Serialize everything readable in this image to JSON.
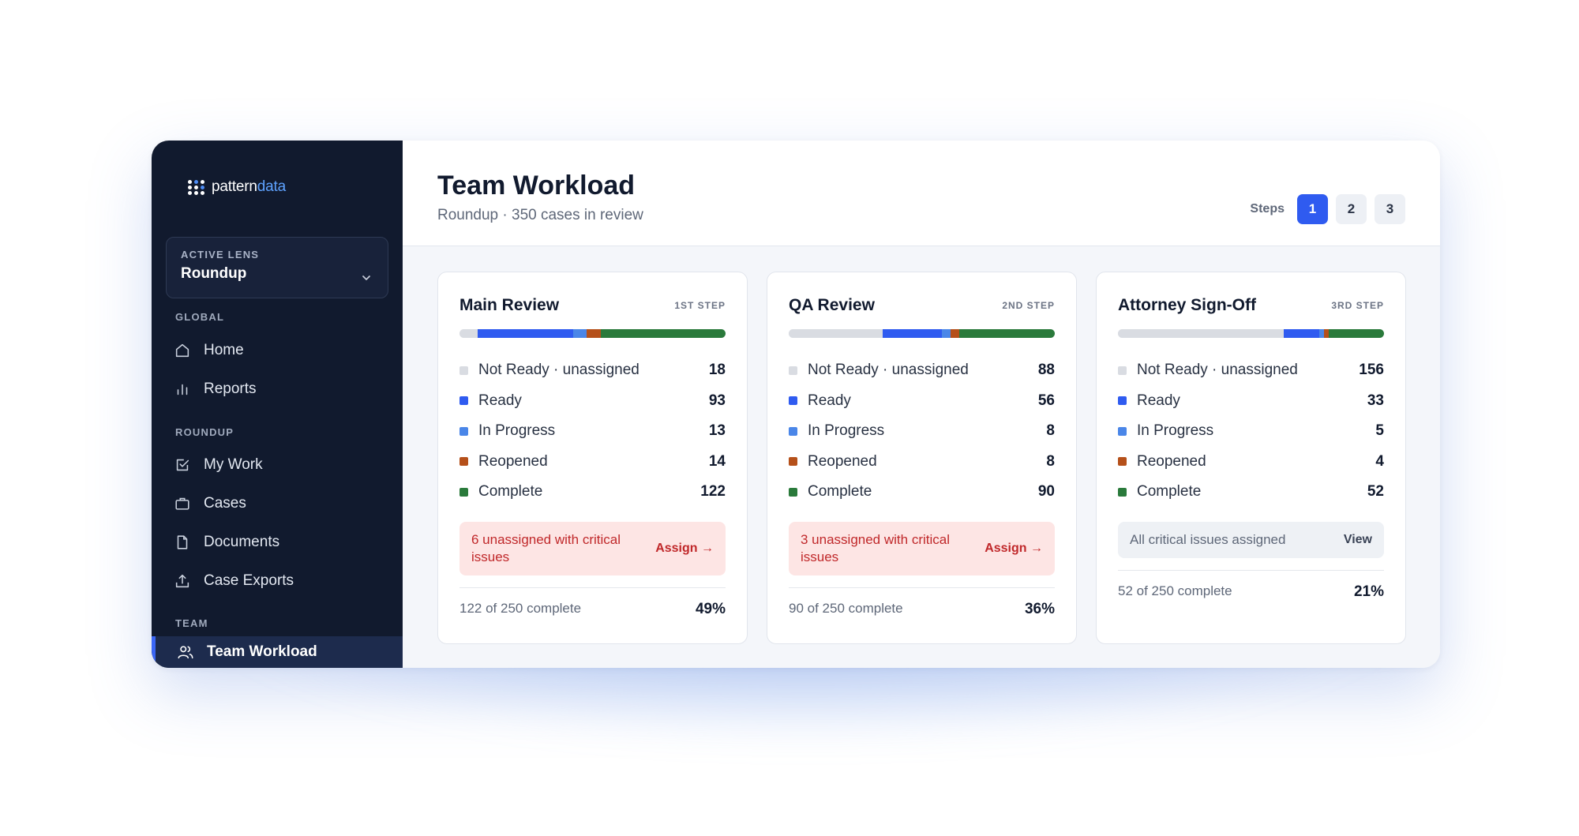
{
  "brand": {
    "name_part1": "pattern",
    "name_part2": "data"
  },
  "lens": {
    "label": "ACTIVE LENS",
    "value": "Roundup"
  },
  "sidebar": {
    "sections": [
      {
        "label": "GLOBAL",
        "items": [
          {
            "label": "Home",
            "icon": "home-icon"
          },
          {
            "label": "Reports",
            "icon": "bar-chart-icon"
          }
        ]
      },
      {
        "label": "ROUNDUP",
        "items": [
          {
            "label": "My Work",
            "icon": "checkbox-icon"
          },
          {
            "label": "Cases",
            "icon": "briefcase-icon"
          },
          {
            "label": "Documents",
            "icon": "document-icon"
          },
          {
            "label": "Case Exports",
            "icon": "upload-icon"
          }
        ]
      },
      {
        "label": "TEAM",
        "items": [
          {
            "label": "Team Workload",
            "icon": "users-icon",
            "active": true
          }
        ]
      }
    ]
  },
  "header": {
    "title": "Team Workload",
    "subtitle": "Roundup · 350 cases in review",
    "steps_label": "Steps",
    "steps": [
      "1",
      "2",
      "3"
    ],
    "active_step": "1"
  },
  "colors": {
    "not_ready": "#d9dce2",
    "ready": "#2f5bf0",
    "in_progress": "#4a86e8",
    "reopened": "#b5501a",
    "complete": "#2a7a3b"
  },
  "status_labels": {
    "not_ready": "Not Ready · unassigned",
    "ready": "Ready",
    "in_progress": "In Progress",
    "reopened": "Reopened",
    "complete": "Complete"
  },
  "cards": [
    {
      "title": "Main Review",
      "step": "1ST STEP",
      "counts": {
        "not_ready": 18,
        "ready": 93,
        "in_progress": 13,
        "reopened": 14,
        "complete": 122
      },
      "alert": {
        "type": "critical",
        "text": "6 unassigned with critical issues",
        "action": "Assign →"
      },
      "footer": {
        "text": "122 of 250 complete",
        "pct": "49%"
      }
    },
    {
      "title": "QA Review",
      "step": "2ND STEP",
      "counts": {
        "not_ready": 88,
        "ready": 56,
        "in_progress": 8,
        "reopened": 8,
        "complete": 90
      },
      "alert": {
        "type": "critical",
        "text": "3 unassigned with critical issues",
        "action": "Assign →"
      },
      "footer": {
        "text": "90 of 250 complete",
        "pct": "36%"
      }
    },
    {
      "title": "Attorney Sign-Off",
      "step": "3RD STEP",
      "counts": {
        "not_ready": 156,
        "ready": 33,
        "in_progress": 5,
        "reopened": 4,
        "complete": 52
      },
      "alert": {
        "type": "ok",
        "text": "All critical issues assigned",
        "action": "View"
      },
      "footer": {
        "text": "52 of 250 complete",
        "pct": "21%"
      }
    }
  ]
}
